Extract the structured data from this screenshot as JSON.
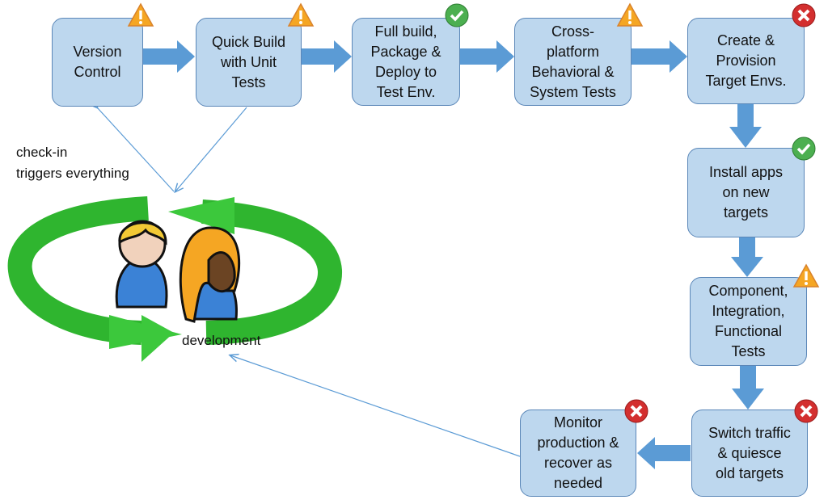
{
  "steps": [
    {
      "label": "Version\nControl",
      "status": "warning"
    },
    {
      "label": "Quick Build\nwith Unit\nTests",
      "status": "warning"
    },
    {
      "label": "Full build,\nPackage &\nDeploy to\nTest Env.",
      "status": "success"
    },
    {
      "label": "Cross-\nplatform\nBehavioral &\nSystem Tests",
      "status": "warning"
    },
    {
      "label": "Create &\nProvision\nTarget Envs.",
      "status": "failure"
    },
    {
      "label": "Install apps\non new\ntargets",
      "status": "success"
    },
    {
      "label": "Component,\nIntegration,\nFunctional\nTests",
      "status": "warning"
    },
    {
      "label": "Switch traffic\n& quiesce\nold targets",
      "status": "failure"
    },
    {
      "label": "Monitor\nproduction &\nrecover as\nneeded",
      "status": "failure"
    }
  ],
  "annotations": {
    "checkin": "check-in\ntriggers everything",
    "development": "development"
  },
  "colors": {
    "box_fill": "#bdd7ee",
    "box_border": "#5b87b8",
    "flow_arrow": "#5b9bd5",
    "cycle": "#3cc83c",
    "warning": "#f5a623",
    "success": "#4caf50",
    "failure": "#d32f2f"
  }
}
